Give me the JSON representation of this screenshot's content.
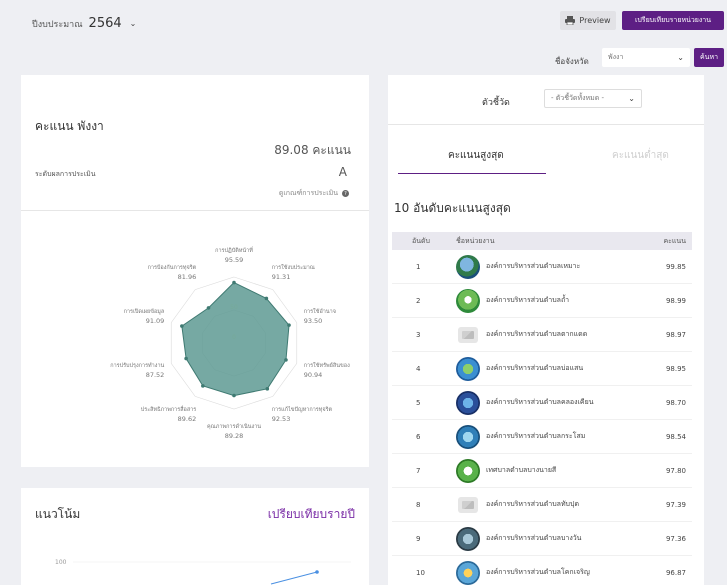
{
  "header": {
    "year_label": "ปีงบประมาณ",
    "year_value": "2564",
    "preview_label": "Preview",
    "compare_label": "เปรียบเทียบรายหน่วยงาน",
    "province_label": "ชื่อจังหวัด",
    "province_value": "พังงา",
    "search_label": "ค้นหา"
  },
  "score_card": {
    "title": "คะแนน พังงา",
    "score": "89.08 คะแนน",
    "level_label": "ระดับผลการประเมิน",
    "level_value": "A",
    "criteria_link": "ดูเกณฑ์การประเมิน"
  },
  "chart_data": [
    {
      "type": "radar",
      "axis_scale": [
        0,
        50
      ],
      "categories": [
        {
          "label": "การปฏิบัติหน้าที่",
          "value": 95.59
        },
        {
          "label": "การใช้งบประมาณ",
          "value": 91.31
        },
        {
          "label": "การใช้อำนาจ",
          "value": 93.5
        },
        {
          "label": "การใช้ทรัพย์สินของ",
          "value": 90.94
        },
        {
          "label": "การแก้ไขปัญหาการทุจริต",
          "value": 92.53
        },
        {
          "label": "คุณภาพการดำเนินงาน",
          "value": 89.28
        },
        {
          "label": "ประสิทธิภาพการสื่อสาร",
          "value": 89.62
        },
        {
          "label": "การปรับปรุงการทำงาน",
          "value": 87.52
        },
        {
          "label": "การเปิดเผยข้อมูล",
          "value": 91.09
        },
        {
          "label": "การป้องกันการทุจริต",
          "value": 81.96
        }
      ],
      "value_labels": [
        "95.59",
        "91.31",
        "93.50",
        "90.94",
        "92.53",
        "89.28",
        "89.62",
        "87.52",
        "91.09",
        "81.96"
      ],
      "fill_color": "#5e9a93",
      "stroke_color": "#3f7a72"
    },
    {
      "type": "line",
      "yticks": [
        "100"
      ]
    }
  ],
  "trend": {
    "title": "แนวโน้ม",
    "link": "เปรียบเทียบรายปี"
  },
  "ranking": {
    "indicator_label": "ตัวชี้วัด",
    "indicator_value": "- ตัวชี้วัดทั้งหมด -",
    "tab_high": "คะแนนสูงสุด",
    "tab_low": "คะแนนต่ำสุด",
    "title": "10 อันดับคะแนนสูงสุด",
    "columns": [
      "อันดับ",
      "ชื่อหน่วยงาน",
      "คะแนน"
    ],
    "rows": [
      {
        "rank": "1",
        "name": "องค์การบริหารส่วนตำบลเหมาะ",
        "score": "99.85",
        "logo": "logo-a"
      },
      {
        "rank": "2",
        "name": "องค์การบริหารส่วนตำบลถ้ำ",
        "score": "98.99",
        "logo": "logo-b"
      },
      {
        "rank": "3",
        "name": "องค์การบริหารส่วนตำบลตากแดด",
        "score": "98.97",
        "logo": "placeholder"
      },
      {
        "rank": "4",
        "name": "องค์การบริหารส่วนตำบลบ่อแสน",
        "score": "98.95",
        "logo": "logo-c"
      },
      {
        "rank": "5",
        "name": "องค์การบริหารส่วนตำบลคลองเคียน",
        "score": "98.70",
        "logo": "logo-d"
      },
      {
        "rank": "6",
        "name": "องค์การบริหารส่วนตำบลกระโสม",
        "score": "98.54",
        "logo": "logo-e"
      },
      {
        "rank": "7",
        "name": "เทศบาลตำบลบางนายสี",
        "score": "97.80",
        "logo": "logo-f"
      },
      {
        "rank": "8",
        "name": "องค์การบริหารส่วนตำบลทับปุด",
        "score": "97.39",
        "logo": "placeholder"
      },
      {
        "rank": "9",
        "name": "องค์การบริหารส่วนตำบลบางวัน",
        "score": "97.36",
        "logo": "logo-g"
      },
      {
        "rank": "10",
        "name": "องค์การบริหารส่วนตำบลโคกเจริญ",
        "score": "96.87",
        "logo": "logo-h"
      }
    ]
  }
}
